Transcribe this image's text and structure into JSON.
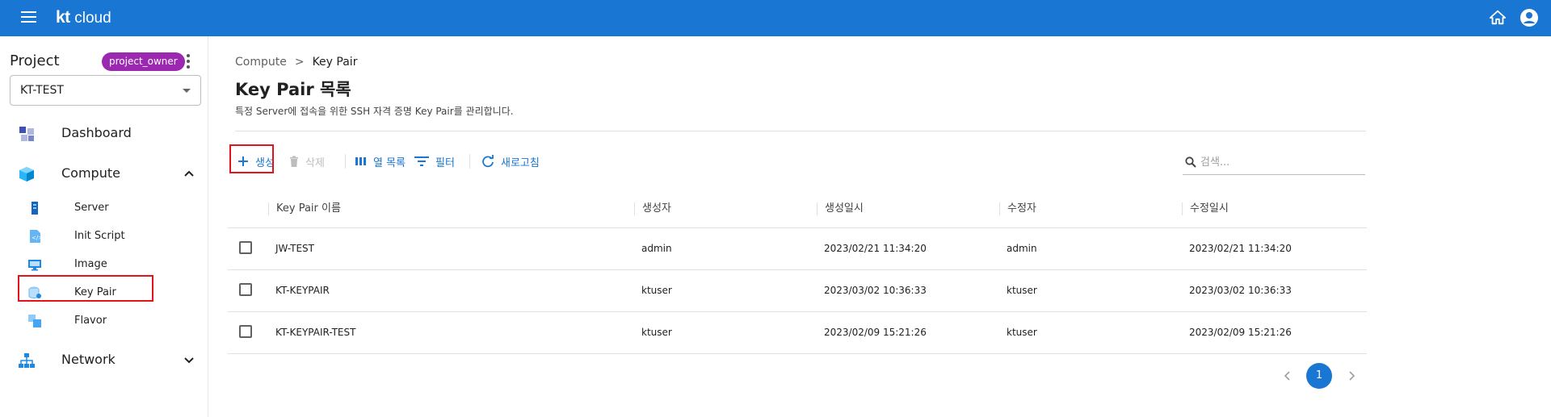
{
  "header": {
    "logo_kt": "kt",
    "logo_cloud": "cloud"
  },
  "sidebar": {
    "project_label": "Project",
    "role_badge": "project_owner",
    "project_value": "KT-TEST",
    "items": [
      {
        "label": "Dashboard"
      },
      {
        "label": "Compute"
      },
      {
        "label": "Server"
      },
      {
        "label": "Init Script"
      },
      {
        "label": "Image"
      },
      {
        "label": "Key Pair"
      },
      {
        "label": "Flavor"
      },
      {
        "label": "Network"
      }
    ]
  },
  "breadcrumb": {
    "parent": "Compute",
    "separator": ">",
    "current": "Key Pair"
  },
  "page": {
    "title": "Key Pair 목록",
    "description": "특정 Server에 접속을 위한 SSH 자격 증명 Key Pair를 관리합니다."
  },
  "toolbar": {
    "create_label": "생성",
    "delete_label": "삭제",
    "columns_label": "열 목록",
    "filter_label": "필터",
    "refresh_label": "새로고침",
    "search_placeholder": "검색..."
  },
  "table": {
    "headers": [
      "Key Pair 이름",
      "생성자",
      "생성일시",
      "수정자",
      "수정일시"
    ],
    "rows": [
      {
        "name": "JW-TEST",
        "creator": "admin",
        "created": "2023/02/21 11:34:20",
        "modifier": "admin",
        "modified": "2023/02/21 11:34:20"
      },
      {
        "name": "KT-KEYPAIR",
        "creator": "ktuser",
        "created": "2023/03/02 10:36:33",
        "modifier": "ktuser",
        "modified": "2023/03/02 10:36:33"
      },
      {
        "name": "KT-KEYPAIR-TEST",
        "creator": "ktuser",
        "created": "2023/02/09 15:21:26",
        "modifier": "ktuser",
        "modified": "2023/02/09 15:21:26"
      }
    ]
  },
  "pagination": {
    "current_page": "1"
  },
  "colors": {
    "primary": "#1976d2",
    "badge": "#9c27b0",
    "highlight": "#e3131b"
  }
}
